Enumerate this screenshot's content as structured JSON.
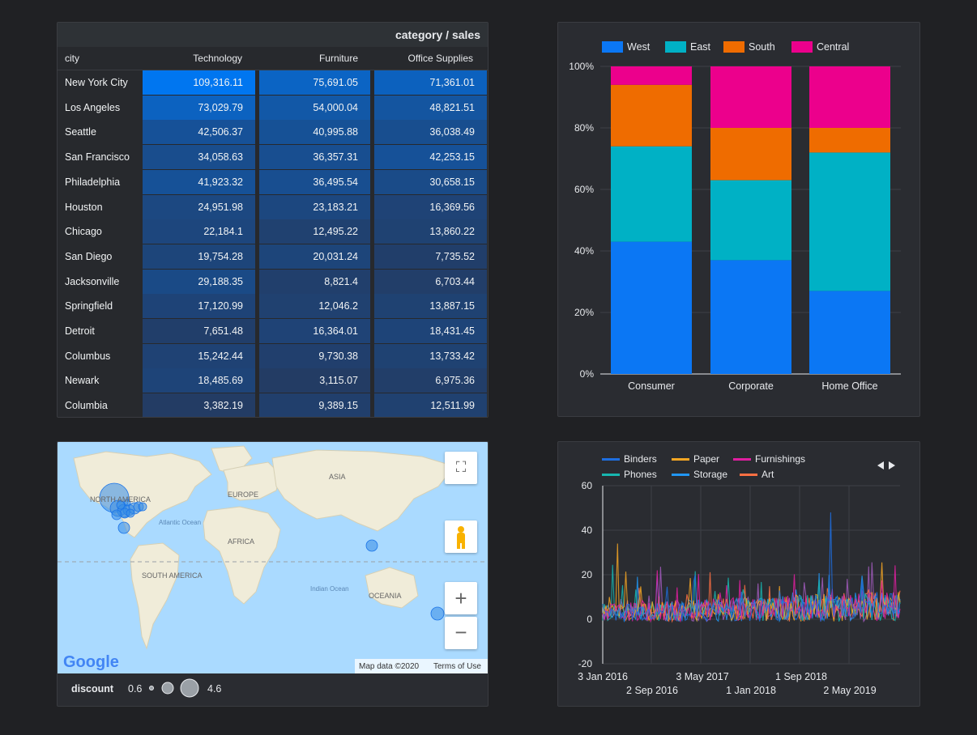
{
  "table": {
    "title": "category / sales",
    "columns": [
      "city",
      "Technology",
      "Furniture",
      "Office Supplies"
    ],
    "rows": [
      [
        "New York City",
        "109,316.11",
        "75,691.05",
        "71,361.01"
      ],
      [
        "Los Angeles",
        "73,029.79",
        "54,000.04",
        "48,821.51"
      ],
      [
        "Seattle",
        "42,506.37",
        "40,995.88",
        "36,038.49"
      ],
      [
        "San Francisco",
        "34,058.63",
        "36,357.31",
        "42,253.15"
      ],
      [
        "Philadelphia",
        "41,923.32",
        "36,495.54",
        "30,658.15"
      ],
      [
        "Houston",
        "24,951.98",
        "23,183.21",
        "16,369.56"
      ],
      [
        "Chicago",
        "22,184.1",
        "12,495.22",
        "13,860.22"
      ],
      [
        "San Diego",
        "19,754.28",
        "20,031.24",
        "7,735.52"
      ],
      [
        "Jacksonville",
        "29,188.35",
        "8,821.4",
        "6,703.44"
      ],
      [
        "Springfield",
        "17,120.99",
        "12,046.2",
        "13,887.15"
      ],
      [
        "Detroit",
        "7,651.48",
        "16,364.01",
        "18,431.45"
      ],
      [
        "Columbus",
        "15,242.44",
        "9,730.38",
        "13,733.42"
      ],
      [
        "Newark",
        "18,485.69",
        "3,115.07",
        "6,975.36"
      ],
      [
        "Columbia",
        "3,382.19",
        "9,389.15",
        "12,511.99"
      ]
    ]
  },
  "map": {
    "labels": [
      "NORTH AMERICA",
      "EUROPE",
      "ASIA",
      "AFRICA",
      "SOUTH AMERICA",
      "OCEANIA",
      "Atlantic Ocean",
      "Indian Ocean"
    ],
    "attribution": "Map data ©2020",
    "terms": "Terms of Use",
    "google": "Google",
    "legend_title": "discount",
    "legend_min": "0.6",
    "legend_max": "4.6",
    "water_color": "#aadaff",
    "land_color": "#f0ecd9"
  },
  "chart_data": [
    {
      "type": "bar",
      "stacked": "percent",
      "categories": [
        "Consumer",
        "Corporate",
        "Home Office"
      ],
      "series": [
        {
          "name": "West",
          "color": "#0b77f4",
          "values": [
            43,
            37,
            27
          ]
        },
        {
          "name": "East",
          "color": "#00b1c5",
          "values": [
            31,
            26,
            45
          ]
        },
        {
          "name": "South",
          "color": "#ef6c00",
          "values": [
            20,
            17,
            8
          ]
        },
        {
          "name": "Central",
          "color": "#ec008c",
          "values": [
            6,
            20,
            20
          ]
        }
      ],
      "y_ticks": [
        "0%",
        "20%",
        "40%",
        "60%",
        "80%",
        "100%"
      ],
      "ylim": [
        0,
        100
      ],
      "legend": "top-left"
    },
    {
      "type": "line",
      "series": [
        {
          "name": "Binders",
          "color": "#1e6ee0"
        },
        {
          "name": "Paper",
          "color": "#f5a623"
        },
        {
          "name": "Furnishings",
          "color": "#e01ea0"
        },
        {
          "name": "Phones",
          "color": "#17b6b0"
        },
        {
          "name": "Storage",
          "color": "#2196f3"
        },
        {
          "name": "Art",
          "color": "#ff7043"
        }
      ],
      "y_ticks": [
        "60",
        "40",
        "20",
        "0",
        "-20"
      ],
      "ylim": [
        -20,
        60
      ],
      "x_ticks_row1": [
        "3 Jan 2016",
        "3 May 2017",
        "1 Sep 2018"
      ],
      "x_ticks_row2": [
        "2 Sep 2016",
        "1 Jan 2018",
        "2 May 2019"
      ],
      "grid": true,
      "legend": "top-left"
    }
  ]
}
